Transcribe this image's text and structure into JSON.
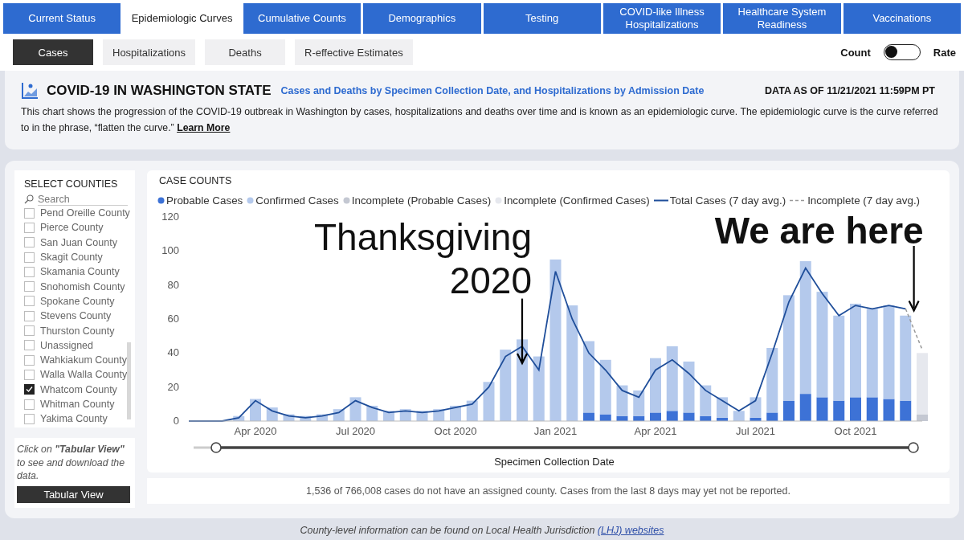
{
  "tabs": [
    {
      "label": "Current Status",
      "selected": false
    },
    {
      "label": "Epidemiologic Curves",
      "selected": true
    },
    {
      "label": "Cumulative Counts",
      "selected": false
    },
    {
      "label": "Demographics",
      "selected": false
    },
    {
      "label": "Testing",
      "selected": false
    },
    {
      "label": "COVID-like Illness Hospitalizations",
      "selected": false
    },
    {
      "label": "Healthcare System Readiness",
      "selected": false
    },
    {
      "label": "Vaccinations",
      "selected": false
    }
  ],
  "subtabs": [
    {
      "label": "Cases",
      "selected": true
    },
    {
      "label": "Hospitalizations",
      "selected": false
    },
    {
      "label": "Deaths",
      "selected": false
    },
    {
      "label": "R-effective Estimates",
      "selected": false
    }
  ],
  "toggle": {
    "left_label": "Count",
    "right_label": "Rate",
    "on": false
  },
  "header": {
    "title": "COVID-19 IN WASHINGTON STATE",
    "subtitle": "Cases and Deaths by Specimen Collection Date, and Hospitalizations by Admission Date",
    "data_as_of": "DATA AS OF 11/21/2021 11:59PM PT",
    "description": "This chart shows the progression of the COVID-19 outbreak in Washington by cases, hospitalizations and deaths over time and is known as an epidemiologic curve. The epidemiologic curve is the curve referred to in the phrase, “flatten the curve.”",
    "link": "Learn More"
  },
  "counties": {
    "title": "SELECT COUNTIES",
    "search_placeholder": "Search",
    "items": [
      {
        "name": "Pend Oreille County",
        "checked": false
      },
      {
        "name": "Pierce County",
        "checked": false
      },
      {
        "name": "San Juan County",
        "checked": false
      },
      {
        "name": "Skagit County",
        "checked": false
      },
      {
        "name": "Skamania County",
        "checked": false
      },
      {
        "name": "Snohomish County",
        "checked": false
      },
      {
        "name": "Spokane County",
        "checked": false
      },
      {
        "name": "Stevens County",
        "checked": false
      },
      {
        "name": "Thurston County",
        "checked": false
      },
      {
        "name": "Unassigned",
        "checked": false
      },
      {
        "name": "Wahkiakum County",
        "checked": false
      },
      {
        "name": "Walla Walla County",
        "checked": false
      },
      {
        "name": "Whatcom County",
        "checked": true
      },
      {
        "name": "Whitman County",
        "checked": false
      },
      {
        "name": "Yakima County",
        "checked": false
      }
    ]
  },
  "tabular_note": "Click on **\"Tabular View\"** to see and download the data.",
  "tabular_button": "Tabular View",
  "chart": {
    "title": "CASE COUNTS",
    "chart_data": {
      "type": "bar",
      "stacked": true,
      "xlabel": "Specimen Collection Date",
      "ylim": [
        0,
        120
      ],
      "yticks": [
        0,
        20,
        40,
        60,
        80,
        100,
        120
      ],
      "categories": [
        null,
        null,
        null,
        null,
        "Apr 2020",
        null,
        null,
        null,
        null,
        null,
        "Jul 2020",
        null,
        null,
        null,
        null,
        null,
        "Oct 2020",
        null,
        null,
        null,
        null,
        null,
        "Jan 2021",
        null,
        null,
        null,
        null,
        null,
        "Apr 2021",
        null,
        null,
        null,
        null,
        null,
        "Jul 2021",
        null,
        null,
        null,
        null,
        null,
        "Oct 2021",
        null,
        null,
        null,
        null
      ],
      "series": [
        {
          "name": "Probable Cases",
          "type": "bar",
          "color": "#3d72d6",
          "values": [
            0,
            0,
            0,
            0,
            0,
            0,
            0,
            0,
            0,
            0,
            0,
            0,
            0,
            0,
            0,
            0,
            0,
            0,
            0,
            0,
            0,
            0,
            0,
            0,
            5,
            4,
            3,
            3,
            5,
            6,
            5,
            3,
            2,
            null,
            2,
            5,
            12,
            16,
            14,
            12,
            14,
            14,
            13,
            12,
            null
          ]
        },
        {
          "name": "Confirmed Cases",
          "type": "bar",
          "color": "#b4c9ec",
          "values": [
            0,
            0,
            0,
            3,
            13,
            8,
            4,
            3,
            4,
            7,
            14,
            9,
            6,
            7,
            6,
            7,
            9,
            12,
            23,
            42,
            48,
            38,
            95,
            68,
            42,
            32,
            18,
            15,
            32,
            38,
            30,
            18,
            12,
            6,
            12,
            38,
            62,
            78,
            62,
            50,
            55,
            52,
            55,
            50,
            null
          ]
        },
        {
          "name": "Incomplete (Probable Cases)",
          "type": "bar",
          "color": "#c4c8d2",
          "values": [
            null,
            null,
            null,
            null,
            null,
            null,
            null,
            null,
            null,
            null,
            null,
            null,
            null,
            null,
            null,
            null,
            null,
            null,
            null,
            null,
            null,
            null,
            null,
            null,
            null,
            null,
            null,
            null,
            null,
            null,
            null,
            null,
            null,
            null,
            null,
            null,
            null,
            null,
            null,
            null,
            null,
            null,
            null,
            null,
            4
          ]
        },
        {
          "name": "Incomplete (Confirmed Cases)",
          "type": "bar",
          "color": "#e6e8ee",
          "values": [
            null,
            null,
            null,
            null,
            null,
            null,
            null,
            null,
            null,
            null,
            null,
            null,
            null,
            null,
            null,
            null,
            null,
            null,
            null,
            null,
            null,
            null,
            null,
            null,
            null,
            null,
            null,
            null,
            null,
            null,
            null,
            null,
            null,
            null,
            null,
            null,
            null,
            null,
            null,
            null,
            null,
            null,
            null,
            null,
            36
          ]
        },
        {
          "name": "Total Cases (7 day avg.)",
          "type": "line",
          "line_style": "solid",
          "color": "#1f4e9a",
          "values": [
            0,
            0,
            0,
            2,
            12,
            6,
            3,
            2,
            3,
            5,
            12,
            8,
            5,
            6,
            5,
            6,
            8,
            10,
            20,
            38,
            44,
            30,
            88,
            60,
            40,
            30,
            18,
            14,
            30,
            36,
            28,
            18,
            12,
            6,
            12,
            40,
            70,
            90,
            75,
            62,
            68,
            66,
            68,
            66,
            null
          ]
        },
        {
          "name": "Incomplete (7 day avg.)",
          "type": "line",
          "line_style": "dashed",
          "color": "#999999",
          "values": [
            null,
            null,
            null,
            null,
            null,
            null,
            null,
            null,
            null,
            null,
            null,
            null,
            null,
            null,
            null,
            null,
            null,
            null,
            null,
            null,
            null,
            null,
            null,
            null,
            null,
            null,
            null,
            null,
            null,
            null,
            null,
            null,
            null,
            null,
            null,
            null,
            null,
            null,
            null,
            null,
            null,
            null,
            null,
            66,
            42
          ]
        }
      ],
      "annotations": [
        "Thanksgiving 2020",
        "We are here"
      ]
    }
  },
  "footnote": "1,536 of 766,008 cases do not have an assigned county. Cases from the last 8 days may yet not be reported.",
  "bottom_note": {
    "text": "County-level information can be found on Local Health Jurisdiction",
    "link": "(LHJ) websites"
  }
}
